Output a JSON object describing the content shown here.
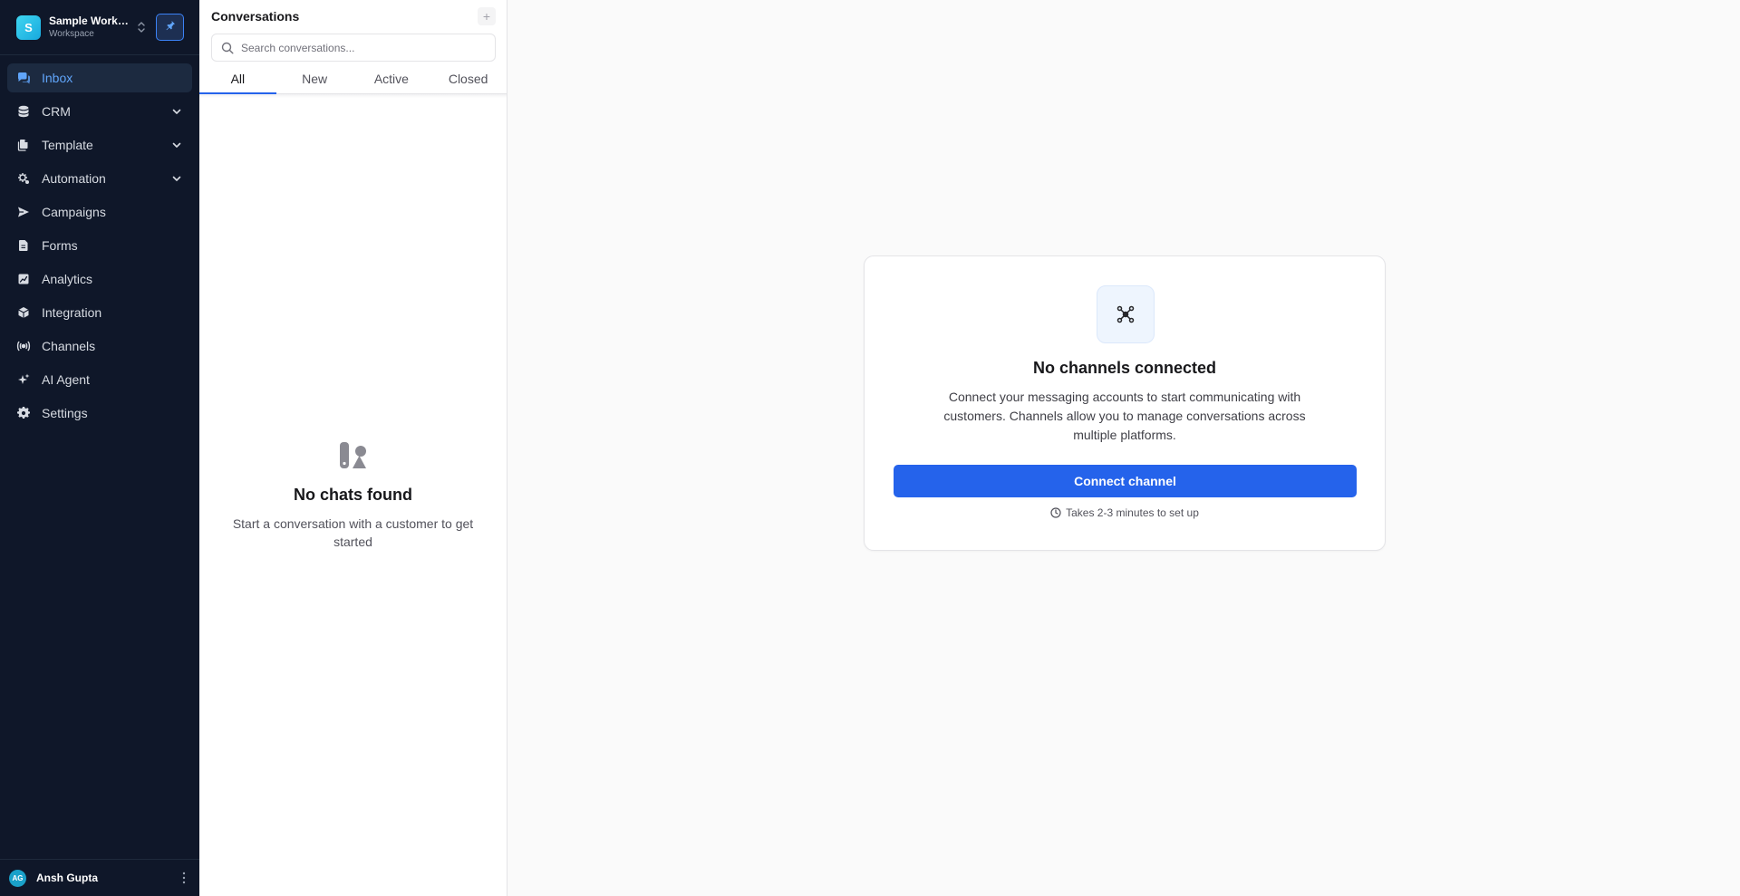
{
  "workspace": {
    "initial": "S",
    "name": "Sample Workspace",
    "label": "Workspace"
  },
  "nav": {
    "items": [
      {
        "label": "Inbox",
        "icon": "inbox-icon",
        "active": true,
        "expandable": false
      },
      {
        "label": "CRM",
        "icon": "database-icon",
        "active": false,
        "expandable": true
      },
      {
        "label": "Template",
        "icon": "files-icon",
        "active": false,
        "expandable": true
      },
      {
        "label": "Automation",
        "icon": "automation-icon",
        "active": false,
        "expandable": true
      },
      {
        "label": "Campaigns",
        "icon": "send-icon",
        "active": false,
        "expandable": false
      },
      {
        "label": "Forms",
        "icon": "form-icon",
        "active": false,
        "expandable": false
      },
      {
        "label": "Analytics",
        "icon": "analytics-icon",
        "active": false,
        "expandable": false
      },
      {
        "label": "Integration",
        "icon": "box-icon",
        "active": false,
        "expandable": false
      },
      {
        "label": "Channels",
        "icon": "broadcast-icon",
        "active": false,
        "expandable": false
      },
      {
        "label": "AI Agent",
        "icon": "sparkles-icon",
        "active": false,
        "expandable": false
      },
      {
        "label": "Settings",
        "icon": "gear-icon",
        "active": false,
        "expandable": false
      }
    ]
  },
  "user": {
    "initials": "AG",
    "name": "Ansh Gupta"
  },
  "conversations": {
    "title": "Conversations",
    "add_symbol": "+",
    "search_placeholder": "Search conversations...",
    "tabs": [
      {
        "label": "All",
        "active": true
      },
      {
        "label": "New",
        "active": false
      },
      {
        "label": "Active",
        "active": false
      },
      {
        "label": "Closed",
        "active": false
      }
    ],
    "empty_title": "No chats found",
    "empty_desc": "Start a conversation with a customer to get started"
  },
  "main": {
    "title": "No channels connected",
    "description": "Connect your messaging accounts to start communicating with customers. Channels allow you to manage conversations across multiple platforms.",
    "button_label": "Connect channel",
    "setup_note": "Takes 2-3 minutes to set up"
  },
  "colors": {
    "sidebar_bg": "#0f1729",
    "accent": "#2563eb",
    "active_nav_text": "#60a5fa"
  }
}
